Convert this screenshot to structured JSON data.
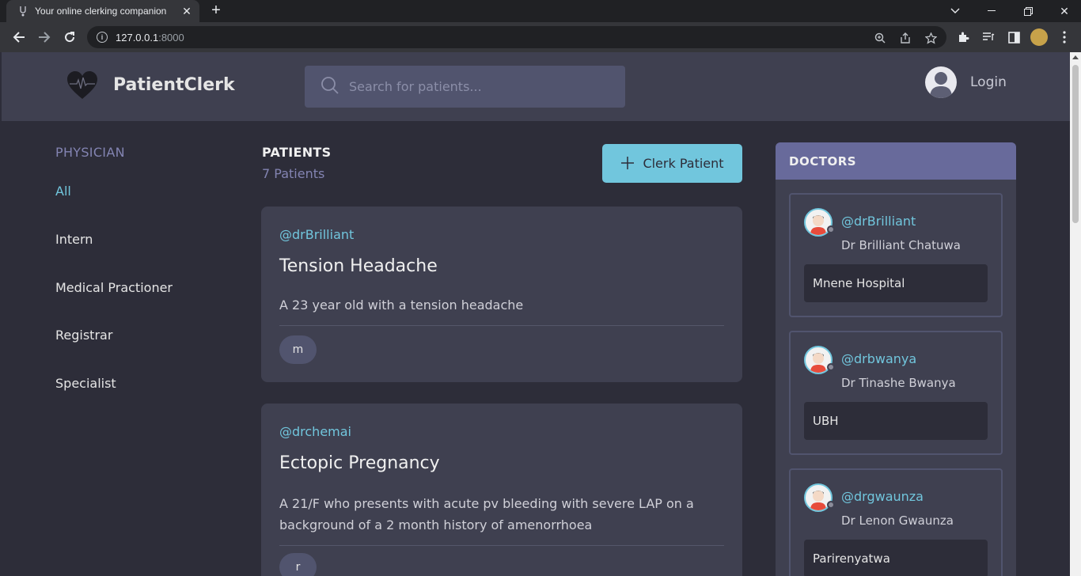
{
  "browser": {
    "tab_title": "Your online clerking companion",
    "url_host": "127.0.0.1",
    "url_port": ":8000"
  },
  "header": {
    "brand": "PatientClerk",
    "search_placeholder": "Search for patients...",
    "login_label": "Login"
  },
  "sidebar": {
    "title": "PHYSICIAN",
    "items": [
      {
        "label": "All",
        "active": true
      },
      {
        "label": "Intern"
      },
      {
        "label": "Medical Practioner"
      },
      {
        "label": "Registrar"
      },
      {
        "label": "Specialist"
      }
    ]
  },
  "main": {
    "title": "PATIENTS",
    "count": "7 Patients",
    "clerk_button": "Clerk Patient",
    "cards": [
      {
        "handle": "@drBrilliant",
        "title": "Tension Headache",
        "description": "A 23 year old with a tension headache",
        "tag": "m"
      },
      {
        "handle": "@drchemai",
        "title": "Ectopic Pregnancy",
        "description": "A 21/F who presents with acute pv bleeding with severe LAP on a background of a 2 month history of amenorrhoea",
        "tag": "r"
      }
    ]
  },
  "doctors": {
    "title": "DOCTORS",
    "items": [
      {
        "handle": "@drBrilliant",
        "name": "Dr Brilliant Chatuwa",
        "hospital": "Mnene Hospital"
      },
      {
        "handle": "@drbwanya",
        "name": "Dr Tinashe Bwanya",
        "hospital": "UBH"
      },
      {
        "handle": "@drgwaunza",
        "name": "Dr Lenon Gwaunza",
        "hospital": "Parirenyatwa"
      }
    ]
  },
  "colors": {
    "accent": "#71c6dd",
    "background": "#2d2d39",
    "panel": "#3f4050",
    "muted_purple": "#8384b2",
    "doctors_header": "#686a9b"
  }
}
